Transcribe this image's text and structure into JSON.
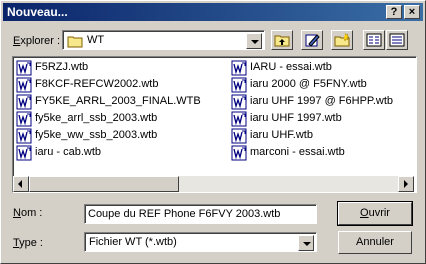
{
  "window": {
    "title": "Nouveau...",
    "help_label": "?",
    "close_label": "×"
  },
  "explorer": {
    "label_underlined": "E",
    "label_rest": "xplorer :",
    "location": "WT",
    "location_icon": "folder-icon"
  },
  "toolbar": {
    "up_icon": "folder-up-icon",
    "desktop_icon": "edit-icon",
    "newfolder_icon": "new-folder-icon",
    "list_icon": "list-view-icon",
    "details_icon": "details-view-icon"
  },
  "files": {
    "left": [
      "F5RZJ.wtb",
      "F8KCF-REFCW2002.wtb",
      "FY5KE_ARRL_2003_FINAL.WTB",
      "fy5ke_arrl_ssb_2003.wtb",
      "fy5ke_ww_ssb_2003.wtb",
      "iaru - cab.wtb"
    ],
    "right": [
      "IARU - essai.wtb",
      "iaru 2000 @ F5FNY.wtb",
      "iaru UHF 1997 @ F6HPP.wtb",
      "iaru UHF 1997.wtb",
      "iaru UHF.wtb",
      "marconi - essai.wtb"
    ],
    "icon": "wtb-file-icon"
  },
  "filename": {
    "label_underlined": "N",
    "label_rest": "om :",
    "value": "Coupe du REF Phone F6FVY 2003.wtb"
  },
  "filetype": {
    "label_underlined": "T",
    "label_rest": "ype :",
    "value": "Fichier WT (*.wtb)"
  },
  "buttons": {
    "open_underlined": "O",
    "open_rest": "uvrir",
    "cancel": "Annuler"
  }
}
